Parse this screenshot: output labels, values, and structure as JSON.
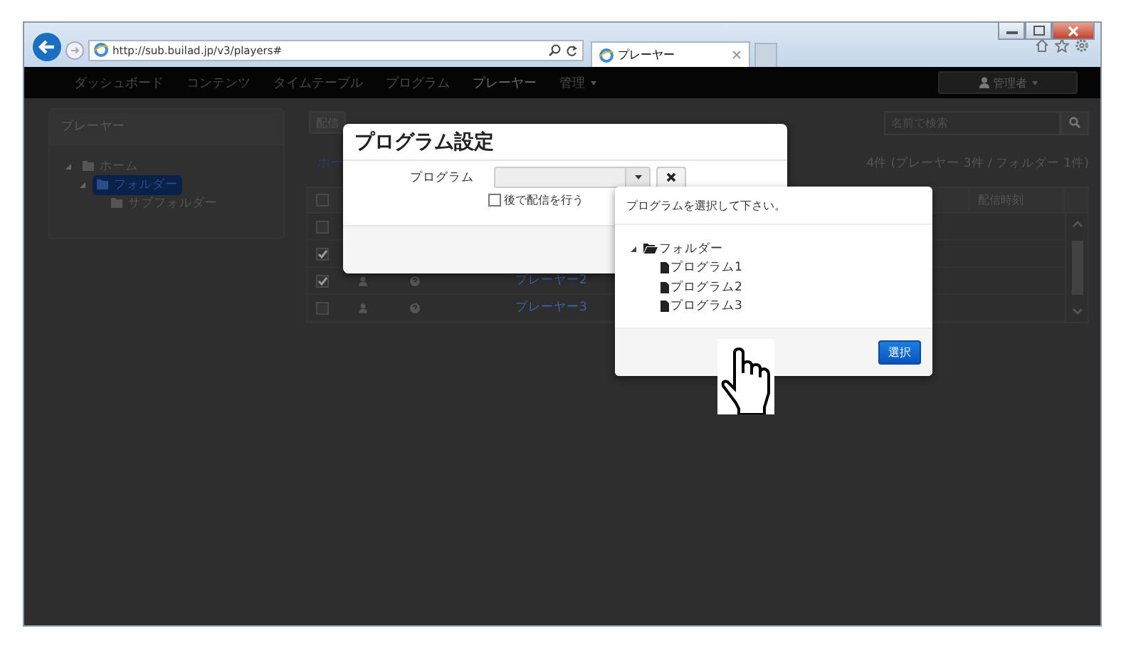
{
  "browser": {
    "url": "http://sub.builad.jp/v3/players#",
    "tab_title": "プレーヤー"
  },
  "nav": {
    "items": [
      {
        "label": "ダッシュボード",
        "selected": false,
        "dropdown": false
      },
      {
        "label": "コンテンツ",
        "selected": false,
        "dropdown": false
      },
      {
        "label": "タイムテーブル",
        "selected": false,
        "dropdown": false
      },
      {
        "label": "プログラム",
        "selected": false,
        "dropdown": false
      },
      {
        "label": "プレーヤー",
        "selected": true,
        "dropdown": false
      },
      {
        "label": "管理",
        "selected": false,
        "dropdown": true
      }
    ],
    "user": "管理者"
  },
  "sidebar": {
    "title": "プレーヤー",
    "tree": [
      {
        "label": "ホーム",
        "selected": false,
        "expanded": true,
        "children": [
          {
            "label": "フォルダー",
            "selected": true,
            "expanded": true,
            "children": [
              {
                "label": "サブフォルダー",
                "selected": false
              }
            ]
          }
        ]
      }
    ]
  },
  "main": {
    "button": "配信",
    "breadcrumb": "ホー",
    "search": {
      "placeholder": "名前で検索"
    },
    "count": "4件 (プレーヤー 3件 / フォルダー 1件)",
    "table": {
      "header_checked": false,
      "last_column": "配信時刻",
      "rows": [
        {
          "checked": false
        },
        {
          "checked": true
        },
        {
          "checked": true,
          "name": "プレーヤー2"
        },
        {
          "checked": false,
          "name": "プレーヤー3"
        }
      ]
    }
  },
  "modal": {
    "title": "プログラム設定",
    "field_label": "プログラム",
    "later": {
      "label": "後で配信を行う",
      "checked": false
    }
  },
  "picker": {
    "prompt": "プログラムを選択して下さい。",
    "tree": [
      {
        "label": "フォルダー",
        "kind": "folder",
        "expanded": true,
        "children": [
          {
            "label": "プログラム1",
            "kind": "file"
          },
          {
            "label": "プログラム2",
            "kind": "file"
          },
          {
            "label": "プログラム3",
            "kind": "file"
          }
        ]
      }
    ],
    "button": "選択"
  }
}
